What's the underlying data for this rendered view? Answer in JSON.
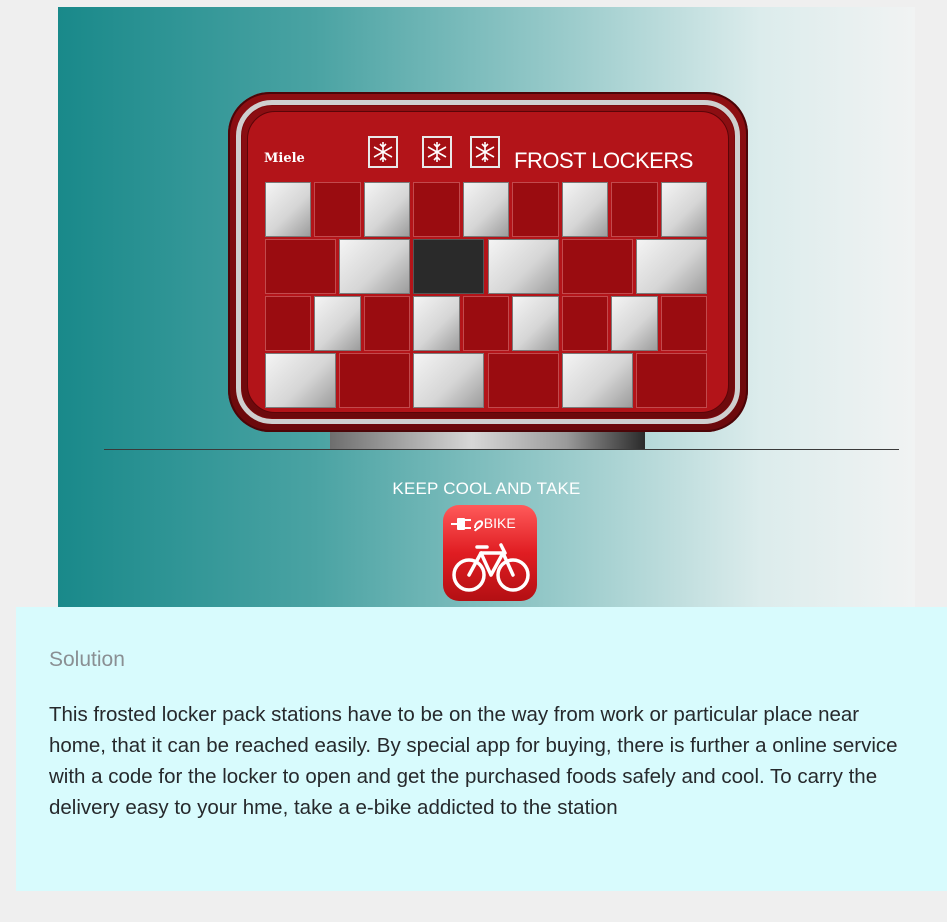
{
  "hero": {
    "brand": "Miele",
    "sign_title": "FROST LOCKERS",
    "tagline": "KEEP COOL AND TAKE",
    "app_label": " BIKE",
    "icons": [
      "snowflake-icon",
      "plug-icon",
      "bicycle-icon"
    ],
    "locker_grid": [
      [
        "white",
        "red",
        "white",
        "red",
        "white",
        "red",
        "white",
        "red",
        "white"
      ],
      [
        "red",
        "white",
        "dark",
        "white",
        "red",
        "white"
      ],
      [
        "red",
        "white",
        "red",
        "white",
        "red",
        "white",
        "red",
        "white",
        "red"
      ],
      [
        "white",
        "red",
        "white",
        "red",
        "white",
        "red"
      ]
    ],
    "colors": {
      "locker_red": "#b31419",
      "teal": "#19898a",
      "app_red": "#e01d22",
      "panel": "#d8fbfd"
    }
  },
  "section": {
    "heading": "Solution",
    "body": "This frosted locker pack stations have to be on the way from work or particular place near home, that it can be reached easily. By special app for buying, there is further a online service with a code for the locker to open and get the purchased foods safely and cool. To carry the delivery easy to your hme, take a e-bike addicted to the station"
  }
}
